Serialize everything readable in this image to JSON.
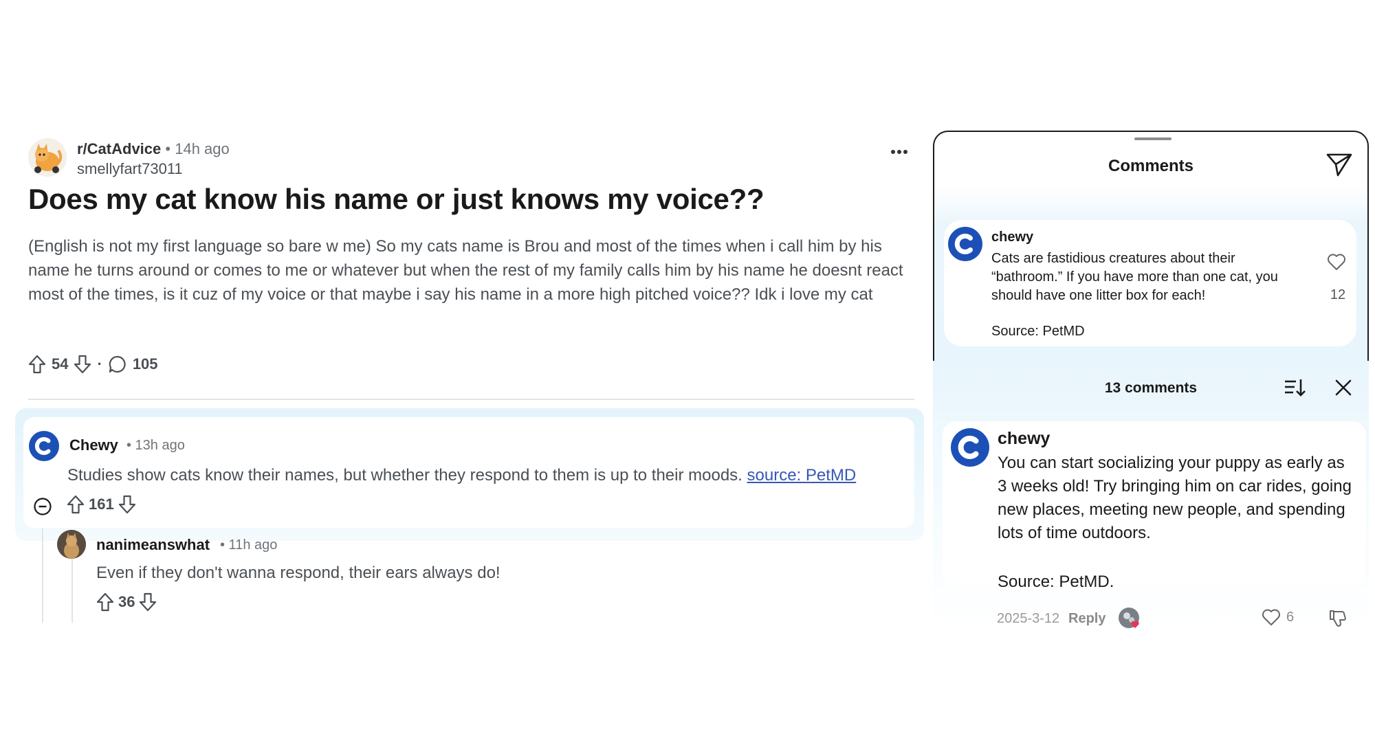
{
  "post": {
    "subreddit": "r/CatAdvice",
    "separator": "•",
    "time": "14h ago",
    "author": "smellyfart73011",
    "menu": "•••",
    "title": "Does my cat know his name or just knows my voice??",
    "body": "(English is not my first language so bare w me) So my cats name is Brou and most of the times when i call him by his name he turns around or comes to me or whatever but when the rest of my family calls him by his name he doesnt react most of the times, is it cuz of my voice or that maybe i say his name in a more high pitched voice?? Idk i love my cat",
    "upvotes": "54",
    "dot": "·",
    "comments": "105"
  },
  "comment": {
    "author": "Chewy",
    "meta": "• 13h ago",
    "text": "Studies show cats know their names, but whether they respond to them is up to their moods.",
    "link": "source: PetMD",
    "score": "161"
  },
  "reply": {
    "author": "nanimeanswhat",
    "meta": "• 11h ago",
    "text": "Even if they don't wanna respond, their ears always do!",
    "score": "36"
  },
  "right_panel": {
    "header": "Comments",
    "top_comment": {
      "author": "chewy",
      "text": "Cats are fastidious creatures about their “bathroom.” If you have more than one cat, you should have one litter box for each!",
      "source": "Source: PetMD",
      "likes": "12"
    },
    "comment_count": "13 comments",
    "second_comment": {
      "author": "chewy",
      "text": "You can start socializing your puppy as early as 3 weeks old! Try bringing him on car rides, going new places, meeting new people, and spending lots of time outdoors.",
      "source": "Source: PetMD.",
      "date": "2025-3-12",
      "reply": "Reply",
      "likes": "6"
    }
  },
  "colors": {
    "chewy_blue": "#1c50b6",
    "link_blue": "#3557b5",
    "panel_tint": "#e8f5fc"
  }
}
